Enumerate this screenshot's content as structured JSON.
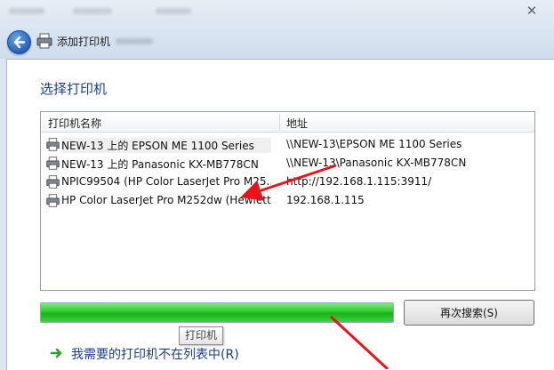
{
  "window": {
    "title": "添加打印机",
    "close_glyph": "✕"
  },
  "page": {
    "heading": "选择打印机"
  },
  "printer_list": {
    "columns": [
      "打印机名称",
      "地址"
    ],
    "rows": [
      {
        "name": "NEW-13 上的 EPSON ME 1100 Series",
        "address": "\\\\NEW-13\\EPSON ME 1100 Series",
        "icon": "printer-icon"
      },
      {
        "name": "NEW-13 上的 Panasonic KX-MB778CN",
        "address": "\\\\NEW-13\\Panasonic KX-MB778CN",
        "icon": "printer-icon"
      },
      {
        "name": "NPIC99504 (HP Color LaserJet Pro M25...",
        "address": "http://192.168.1.115:3911/",
        "icon": "printer-icon"
      },
      {
        "name": "HP Color LaserJet Pro M252dw (Hewlett...",
        "address": "192.168.1.115",
        "icon": "printer-icon"
      }
    ]
  },
  "search": {
    "progress": 1.0,
    "progress_color": "#2fcf2f",
    "research_button": "再次搜索(S)",
    "tooltip": "打印机"
  },
  "not_listed_link": "我需要的打印机不在列表中(R)",
  "colors": {
    "heading": "#1e3f8f",
    "annotation_arrow": "#e8141b",
    "link_arrow": "#2fa02f"
  }
}
